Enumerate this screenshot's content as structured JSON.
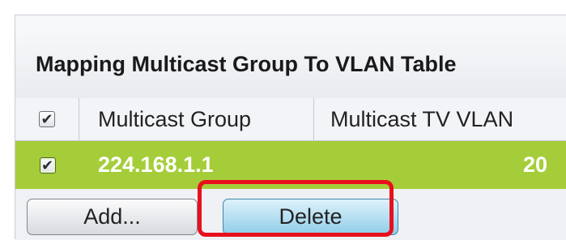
{
  "table": {
    "title": "Mapping Multicast Group To VLAN Table",
    "columns": {
      "select_all_checked": true,
      "multicast_group": "Multicast Group",
      "multicast_tv_vlan": "Multicast TV VLAN"
    },
    "rows": [
      {
        "checked": true,
        "multicast_group": "224.168.1.1",
        "multicast_tv_vlan": "20"
      }
    ]
  },
  "buttons": {
    "add_label": "Add...",
    "delete_label": "Delete"
  },
  "colors": {
    "selected_row": "#a5cd39",
    "highlight_border": "#e8101d",
    "delete_button": "#90cde9"
  },
  "icons": {
    "checkbox_checked": "✔"
  }
}
